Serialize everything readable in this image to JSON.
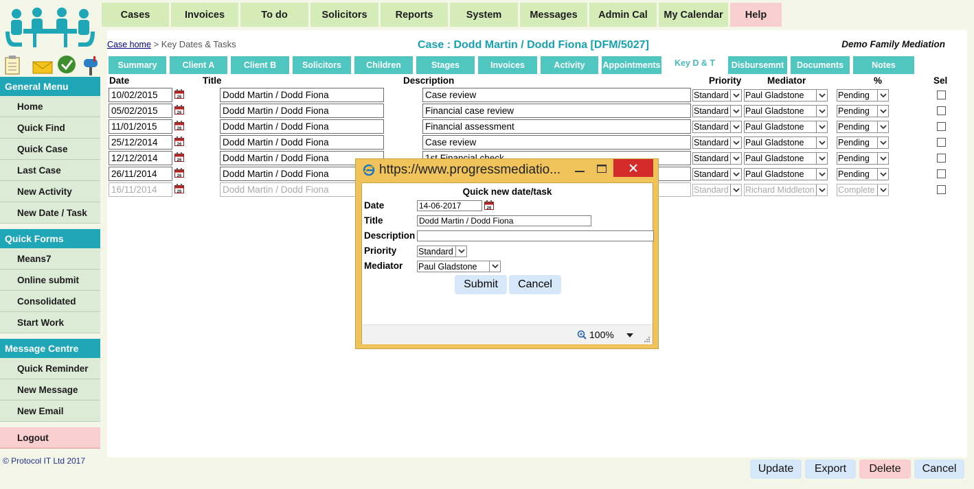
{
  "nav": {
    "items": [
      {
        "label": "Cases"
      },
      {
        "label": "Invoices"
      },
      {
        "label": "To do"
      },
      {
        "label": "Solicitors"
      },
      {
        "label": "Reports"
      },
      {
        "label": "System"
      },
      {
        "label": "Messages"
      },
      {
        "label": "Admin Cal"
      },
      {
        "label": "My Calendar"
      },
      {
        "label": "Help"
      }
    ]
  },
  "sidebar": {
    "general_title": "General Menu",
    "general": [
      "Home",
      "Quick Find",
      "Quick Case",
      "Last Case",
      "New Activity",
      "New Date / Task"
    ],
    "forms_title": "Quick Forms",
    "forms": [
      "Means7",
      "Online submit",
      "Consolidated",
      "Start Work"
    ],
    "messages_title": "Message Centre",
    "messages": [
      "Quick Reminder",
      "New Message",
      "New Email"
    ],
    "logout": "Logout"
  },
  "copyright": "© Protocol IT Ltd 2017",
  "breadcrumb": {
    "home": "Case home",
    "separator": " > ",
    "current": "Key Dates & Tasks"
  },
  "case_title": "Case : Dodd Martin / Dodd Fiona [DFM/5027]",
  "org_name": "Demo Family Mediation",
  "tabs": [
    {
      "label": "Summary"
    },
    {
      "label": "Client A"
    },
    {
      "label": "Client B"
    },
    {
      "label": "Solicitors"
    },
    {
      "label": "Children"
    },
    {
      "label": "Stages"
    },
    {
      "label": "Invoices"
    },
    {
      "label": "Activity"
    },
    {
      "label": "Appointments"
    },
    {
      "label": "Key D & T",
      "active": true
    },
    {
      "label": "Disbursemnt"
    },
    {
      "label": "Documents"
    },
    {
      "label": "Notes"
    }
  ],
  "columns": {
    "date": "Date",
    "title": "Title",
    "description": "Description",
    "priority": "Priority",
    "mediator": "Mediator",
    "percent": "%",
    "sel": "Sel"
  },
  "rows": [
    {
      "date": "10/02/2015",
      "title": "Dodd Martin / Dodd Fiona",
      "description": "Case review",
      "priority": "Standard",
      "mediator": "Paul Gladstone",
      "status": "Pending",
      "muted": false
    },
    {
      "date": "05/02/2015",
      "title": "Dodd Martin / Dodd Fiona",
      "description": "Financial case review",
      "priority": "Standard",
      "mediator": "Paul Gladstone",
      "status": "Pending",
      "muted": false
    },
    {
      "date": "11/01/2015",
      "title": "Dodd Martin / Dodd Fiona",
      "description": "Financial assessment",
      "priority": "Standard",
      "mediator": "Paul Gladstone",
      "status": "Pending",
      "muted": false
    },
    {
      "date": "25/12/2014",
      "title": "Dodd Martin / Dodd Fiona",
      "description": "Case review",
      "priority": "Standard",
      "mediator": "Paul Gladstone",
      "status": "Pending",
      "muted": false
    },
    {
      "date": "12/12/2014",
      "title": "Dodd Martin / Dodd Fiona",
      "description": "1st Financial check",
      "priority": "Standard",
      "mediator": "Paul Gladstone",
      "status": "Pending",
      "muted": false
    },
    {
      "date": "26/11/2014",
      "title": "Dodd Martin / Dodd Fiona",
      "description": "",
      "priority": "Standard",
      "mediator": "Paul Gladstone",
      "status": "Pending",
      "muted": false
    },
    {
      "date": "16/11/2014",
      "title": "Dodd Martin / Dodd Fiona",
      "description": "",
      "priority": "Standard",
      "mediator": "Richard Middleton",
      "status": "Complete",
      "muted": true
    }
  ],
  "calendar_icon_text": "26",
  "buttons": {
    "update": "Update",
    "export": "Export",
    "delete": "Delete",
    "cancel": "Cancel"
  },
  "popup": {
    "url": "https://www.progressmediatio...",
    "heading": "Quick new date/task",
    "date_label": "Date",
    "date_value": "14-06-2017",
    "title_label": "Title",
    "title_value": "Dodd Martin / Dodd Fiona",
    "description_label": "Description",
    "description_value": "",
    "priority_label": "Priority",
    "priority_value": "Standard",
    "mediator_label": "Mediator",
    "mediator_value": "Paul Gladstone",
    "submit": "Submit",
    "cancel": "Cancel",
    "zoom": "100%"
  },
  "colors": {
    "teal": "#1fa7b7",
    "tab": "#4fc7c0",
    "nav": "#d5ecb8",
    "help": "#f9cfcf",
    "popup_frame": "#f0c45a",
    "close": "#d32a2a"
  }
}
